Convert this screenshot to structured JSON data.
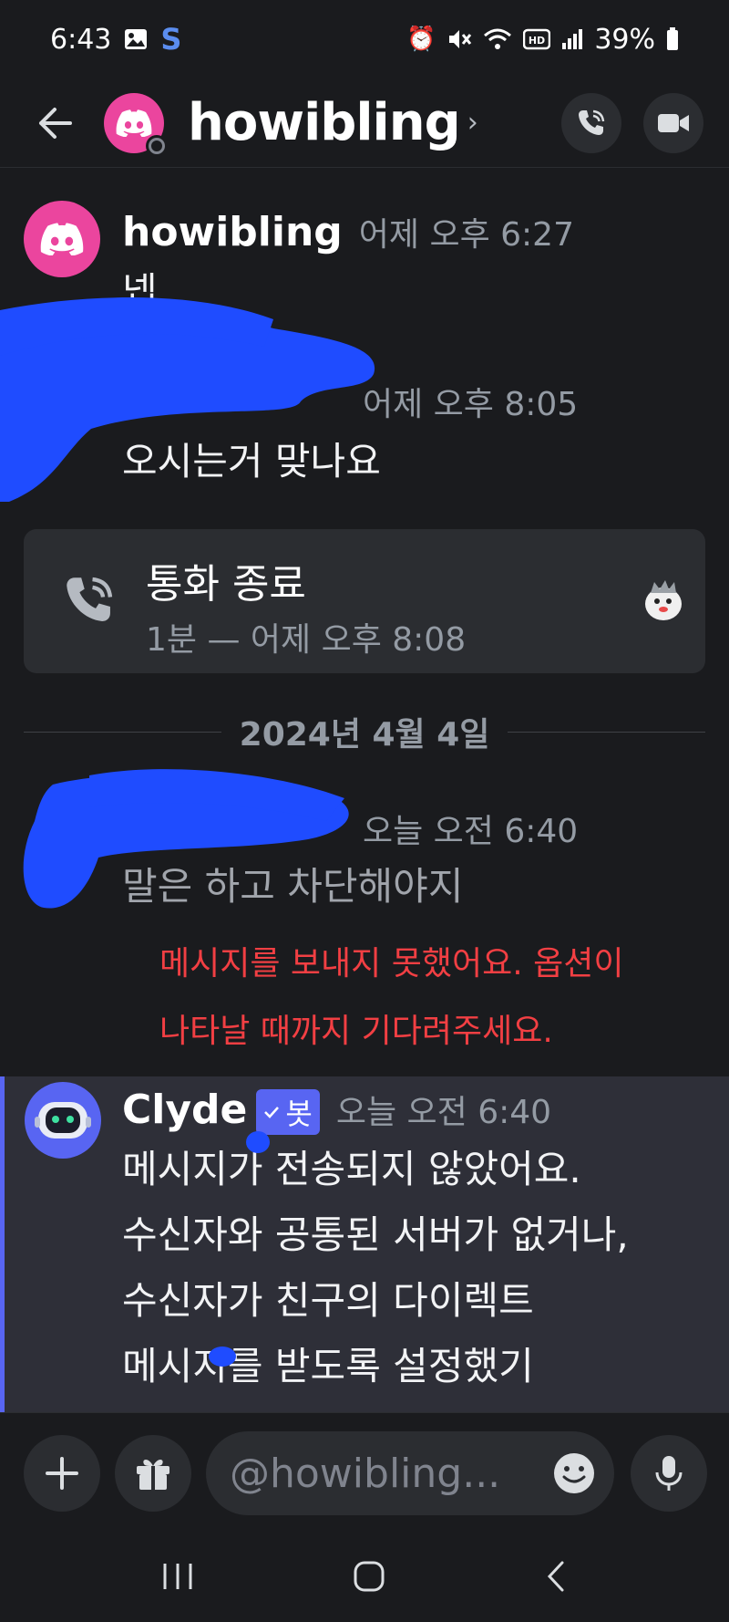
{
  "status_bar": {
    "time": "6:43",
    "app_indicator": "S",
    "battery": "39%"
  },
  "header": {
    "channel_name": "howibling",
    "chevron": "›"
  },
  "messages": [
    {
      "author": "howibling",
      "timestamp": "어제 오후 6:27",
      "text": "넵"
    },
    {
      "author": "",
      "timestamp": "어제 오후 8:05",
      "text": "오시는거 맞나요"
    }
  ],
  "call": {
    "title": "통화 종료",
    "subtitle": "1분 — 어제 오후 8:08"
  },
  "date_divider": "2024년 4월 4일",
  "failed_message": {
    "timestamp": "오늘 오전 6:40",
    "text": "말은 하고 차단해야지",
    "error_line1": "메시지를 보내지 못했어요. 옵션이",
    "error_line2": "나타날 때까지 기다려주세요."
  },
  "clyde": {
    "author": "Clyde",
    "bot_tag": "봇",
    "timestamp": "오늘 오전 6:40",
    "lines": [
      "메시지가 전송되지 않았어요.",
      "수신자와 공통된 서버가 없거나,",
      "수신자가 친구의 다이렉트",
      "메시지를 받도록 설정했기"
    ]
  },
  "composer": {
    "placeholder": "@howibling..."
  },
  "colors": {
    "accent": "#5865f2",
    "brand_pink": "#eb459e",
    "error": "#f23f43",
    "background": "#1a1b1e"
  }
}
